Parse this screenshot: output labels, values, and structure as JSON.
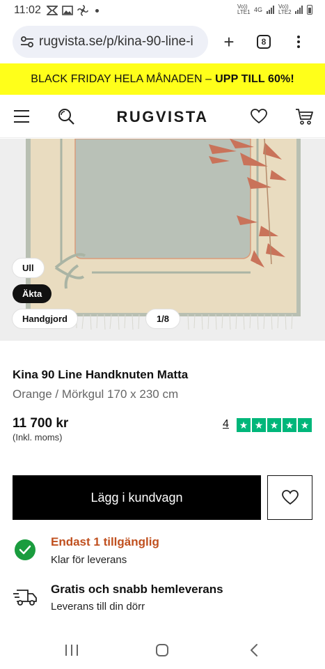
{
  "status_bar": {
    "time": "11:02",
    "network_1": "Vo)) LTE1",
    "network_type": "4G",
    "network_2": "Vo)) LTE2"
  },
  "browser": {
    "url": "rugvista.se/p/kina-90-line-i",
    "tab_count": "8",
    "new_tab_symbol": "+"
  },
  "promo": {
    "text": "BLACK FRIDAY HELA MÅNADEN –",
    "highlight": "UPP TILL 60%!"
  },
  "header": {
    "logo": "RUGVISTA",
    "icons": [
      "menu-icon",
      "search-icon",
      "heart-icon",
      "cart-icon"
    ]
  },
  "gallery": {
    "chips": [
      "Ull",
      "Äkta",
      "Handgjord"
    ],
    "counter": "1/8"
  },
  "product": {
    "name": "Kina 90 Line Handknuten Matta",
    "variant": "Orange / Mörkgul 170 x 230 cm",
    "price": "11 700 kr",
    "price_note": "(Inkl. moms)",
    "review_count": "4",
    "rating_stars": 5,
    "rating_color": "#00b67a"
  },
  "actions": {
    "add_to_cart": "Lägg i kundvagn"
  },
  "availability": {
    "title": "Endast 1 tillgänglig",
    "subtitle": "Klar för leverans",
    "title_color": "#c0501f"
  },
  "shipping": {
    "title": "Gratis och snabb hemleverans",
    "subtitle": "Leverans till din dörr"
  }
}
